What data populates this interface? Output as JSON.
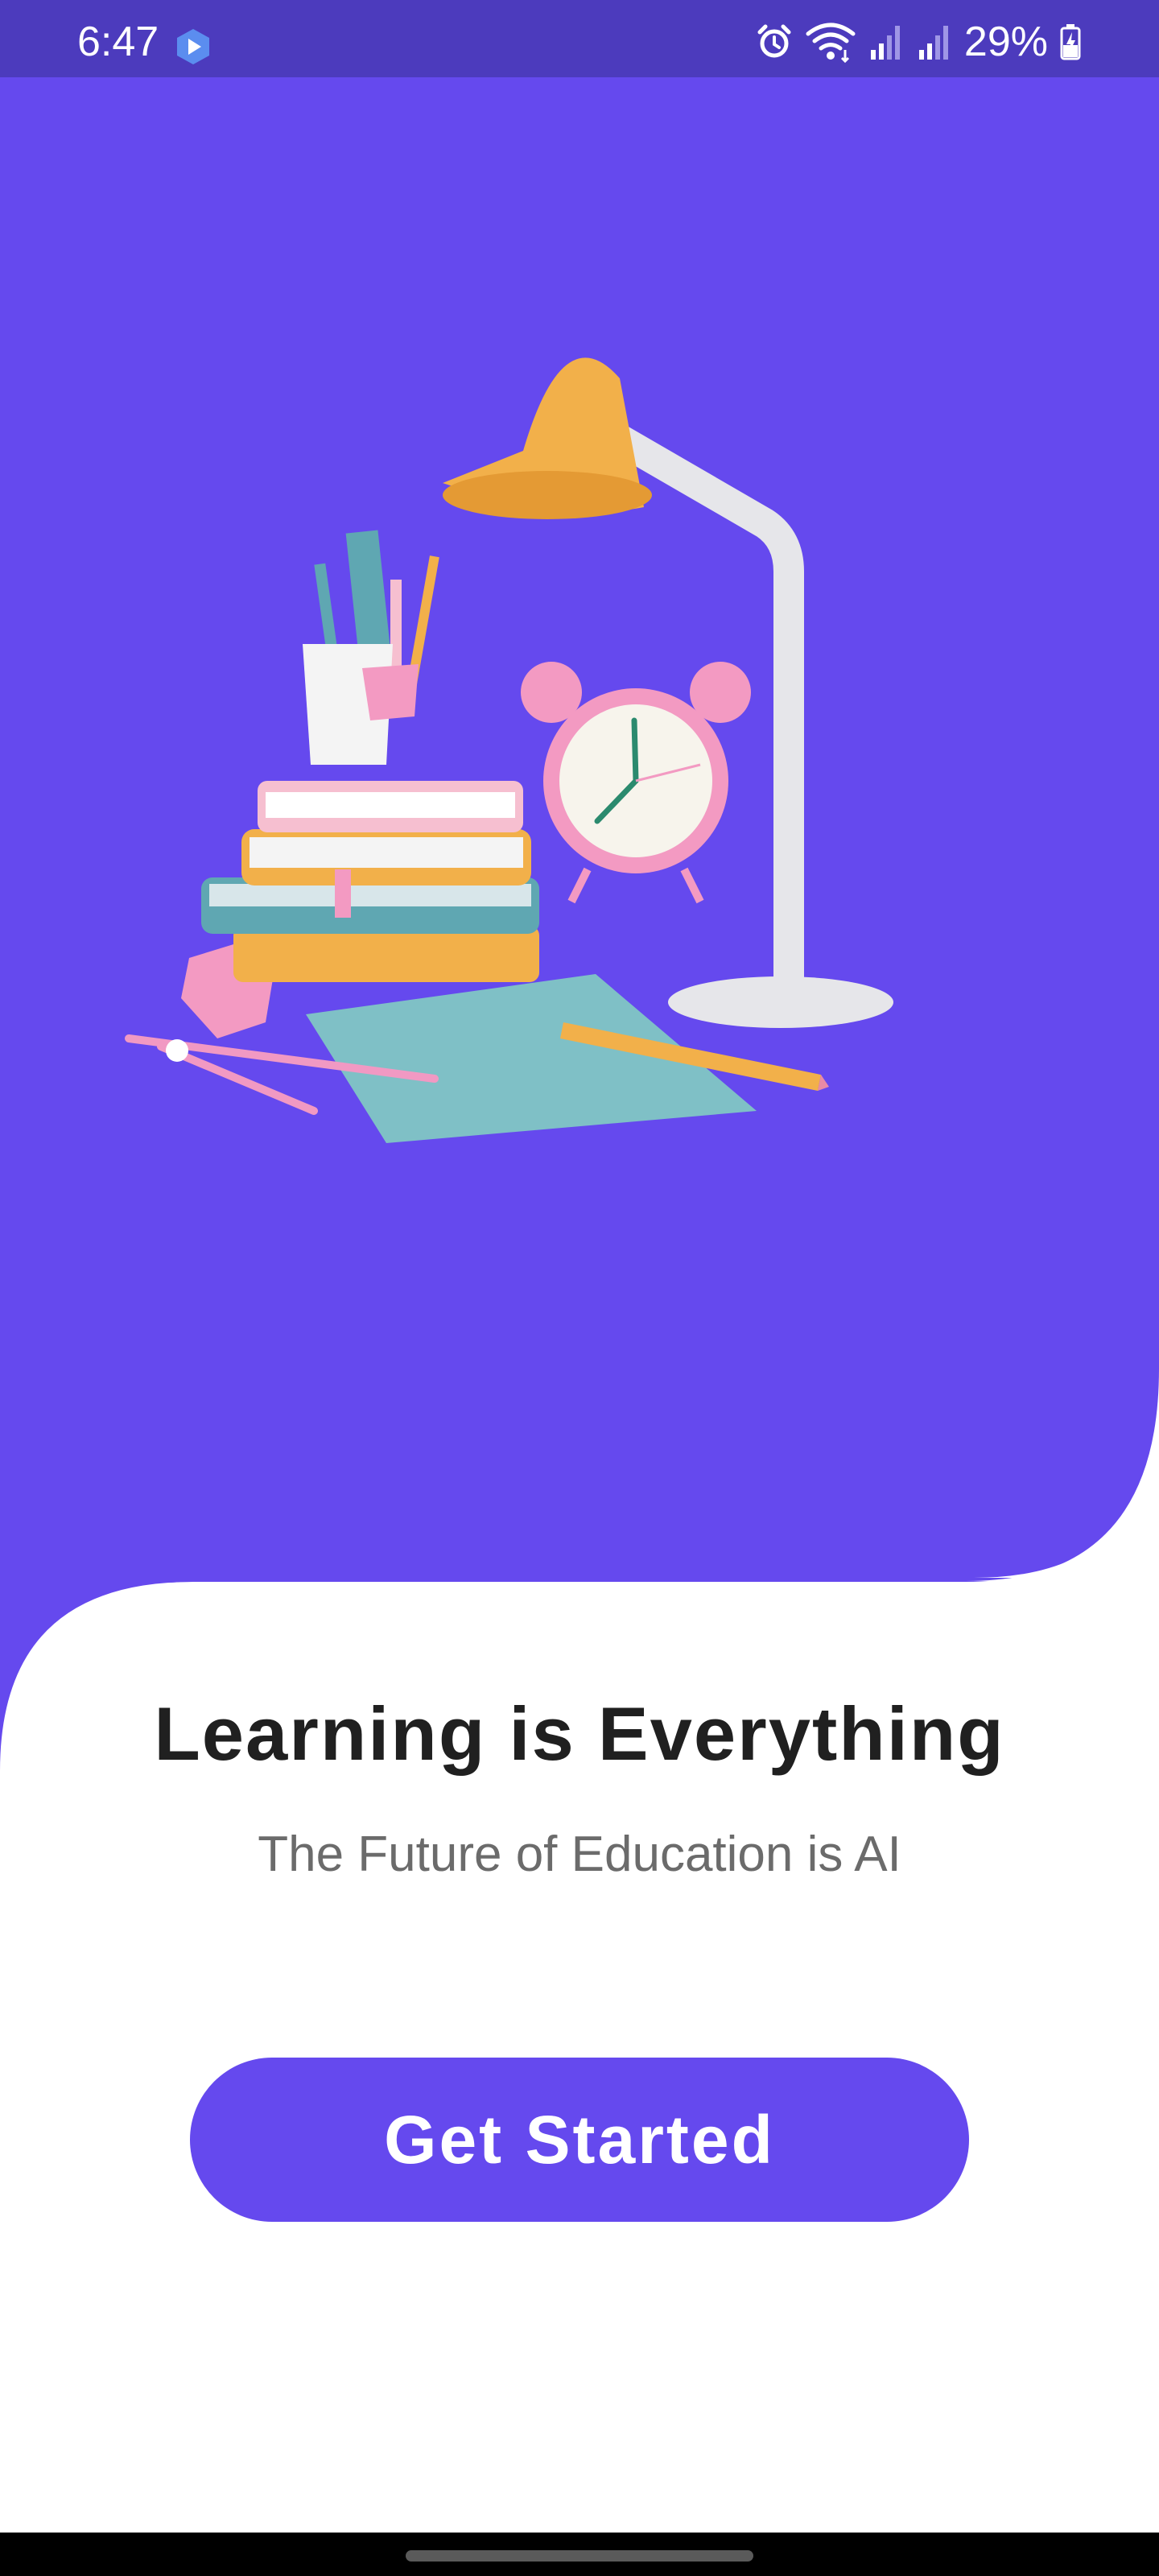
{
  "status_bar": {
    "time": "6:47",
    "battery": "29%",
    "icons": [
      "app-icon",
      "alarm-icon",
      "wifi-icon",
      "signal-icon",
      "signal-icon",
      "battery-charging-icon"
    ]
  },
  "hero": {
    "background_color": "#6549ee",
    "illustration": "desk-study-illustration"
  },
  "content": {
    "headline": "Learning is Everything",
    "subheadline": "The Future of Education is AI",
    "cta_label": "Get Started"
  },
  "colors": {
    "accent": "#6549ee",
    "status_bar": "#4c3bbd",
    "headline": "#202020",
    "subheadline": "#6b6b6b"
  }
}
